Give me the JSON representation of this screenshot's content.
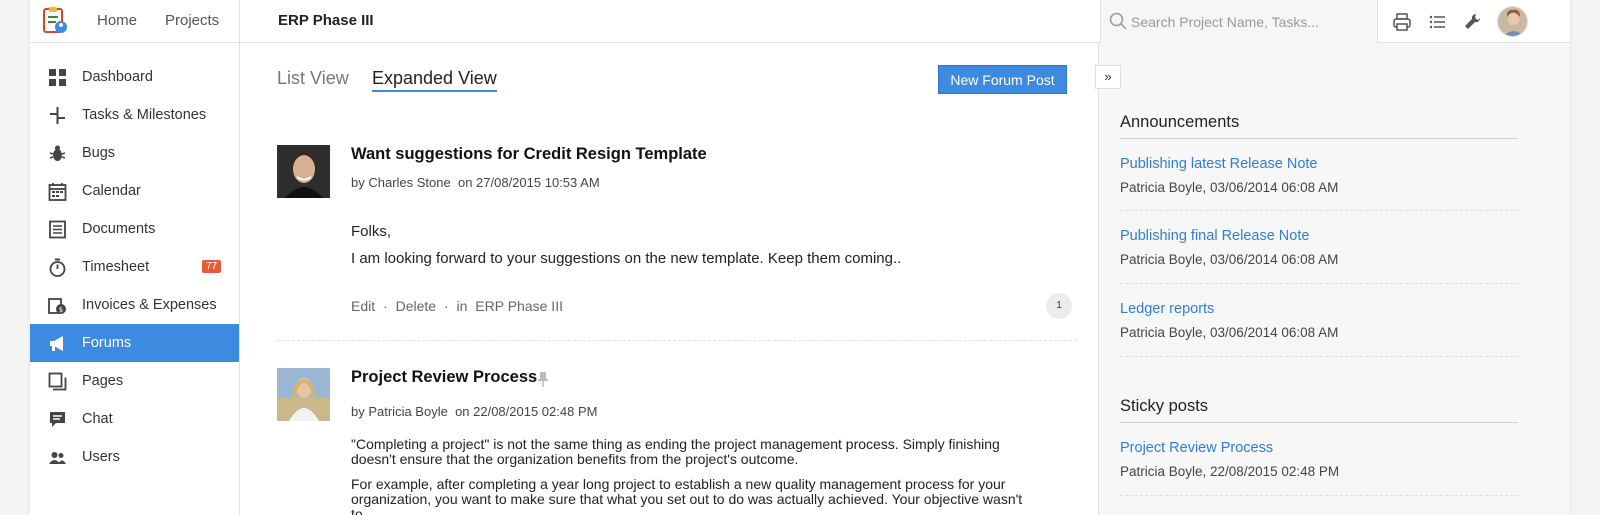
{
  "topbar": {
    "nav": [
      "Home",
      "Projects"
    ],
    "project_title": "ERP Phase III",
    "search_placeholder": "Search Project Name, Tasks..."
  },
  "sidebar": {
    "items": [
      {
        "label": "Dashboard",
        "icon": "dashboard-icon"
      },
      {
        "label": "Tasks & Milestones",
        "icon": "tasks-icon"
      },
      {
        "label": "Bugs",
        "icon": "bug-icon"
      },
      {
        "label": "Calendar",
        "icon": "calendar-icon"
      },
      {
        "label": "Documents",
        "icon": "document-icon"
      },
      {
        "label": "Timesheet",
        "icon": "timer-icon",
        "badge": "77"
      },
      {
        "label": "Invoices & Expenses",
        "icon": "invoice-icon"
      },
      {
        "label": "Forums",
        "icon": "megaphone-icon",
        "active": true
      },
      {
        "label": "Pages",
        "icon": "pages-icon"
      },
      {
        "label": "Chat",
        "icon": "chat-icon"
      },
      {
        "label": "Users",
        "icon": "users-icon"
      }
    ],
    "active_color": "#3d8be0",
    "badge_color": "#e65c3c"
  },
  "main": {
    "tabs": [
      "List View",
      "Expanded View"
    ],
    "new_post_label": "New Forum Post",
    "posts": [
      {
        "title": "Want suggestions for Credit Resign Template",
        "author": "by Charles Stone",
        "date": "on 27/08/2015 10:53 AM",
        "body_line1": "Folks,",
        "body_line2": "I am looking forward to your suggestions on the new template. Keep them coming..",
        "actions": {
          "edit": "Edit",
          "sep1": "·",
          "delete": "Delete",
          "sep2": "·",
          "in": "in",
          "project": "ERP Phase III"
        },
        "comments": "1"
      },
      {
        "title": "Project Review Process",
        "author": "by Patricia Boyle",
        "date": "on 22/08/2015 02:48 PM",
        "para1": "\"Completing a project\" is not the same thing as ending the project management process. Simply finishing doesn't ensure that the organization benefits from the project's outcome.",
        "para2": "For example, after completing a year long project to establish a new quality management process for your organization, you want to make sure that what you set out to do was actually achieved. Your objective wasn't to"
      }
    ]
  },
  "rightpanel": {
    "announcements_title": "Announcements",
    "announcements": [
      {
        "title": "Publishing latest Release Note",
        "meta": "Patricia Boyle,  03/06/2014 06:08 AM"
      },
      {
        "title": "Publishing final Release Note",
        "meta": "Patricia Boyle,  03/06/2014 06:08 AM"
      },
      {
        "title": "Ledger reports",
        "meta": "Patricia Boyle,  03/06/2014 06:08 AM"
      }
    ],
    "sticky_title": "Sticky posts",
    "sticky": [
      {
        "title": "Project Review Process",
        "meta": "Patricia Boyle,  22/08/2015 02:48 PM"
      }
    ],
    "link_color": "#2f7fd0"
  }
}
